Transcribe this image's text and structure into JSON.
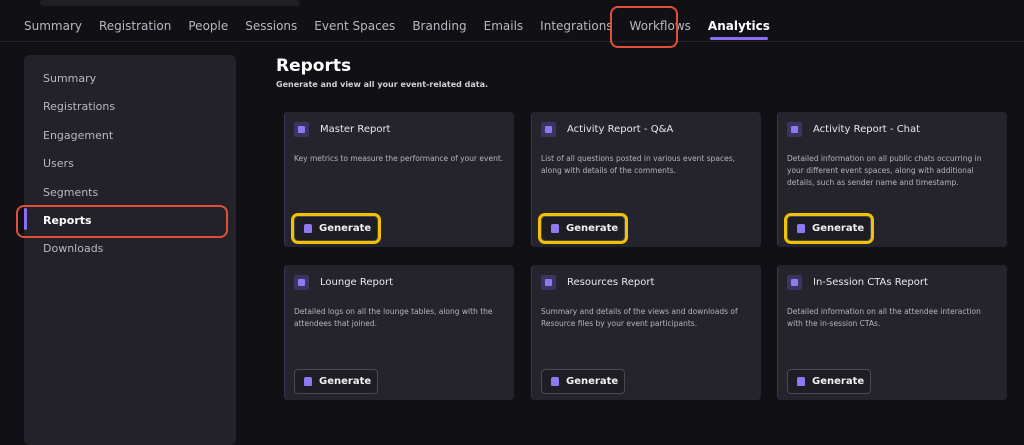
{
  "nav": {
    "tabs": [
      "Summary",
      "Registration",
      "People",
      "Sessions",
      "Event Spaces",
      "Branding",
      "Emails",
      "Integrations",
      "Workflows",
      "Analytics"
    ],
    "active": "Analytics"
  },
  "sidebar": {
    "items": [
      "Summary",
      "Registrations",
      "Engagement",
      "Users",
      "Segments",
      "Reports",
      "Downloads"
    ],
    "active": "Reports"
  },
  "page": {
    "title": "Reports",
    "subtitle": "Generate and view all your event-related data."
  },
  "cards": [
    {
      "title": "Master Report",
      "desc": "Key metrics to measure the performance of your event.",
      "button": "Generate",
      "icon": "document-icon"
    },
    {
      "title": "Activity Report - Q&A",
      "desc": "List of all questions posted in various event spaces, along with details of the comments.",
      "button": "Generate",
      "icon": "qa-icon"
    },
    {
      "title": "Activity Report - Chat",
      "desc": "Detailed information on all public chats occurring in your different event spaces, along with additional details, such as sender name and timestamp.",
      "button": "Generate",
      "icon": "chat-icon"
    },
    {
      "title": "Lounge Report",
      "desc": "Detailed logs on all the lounge tables, along with the attendees that joined.",
      "button": "Generate",
      "icon": "lounge-icon"
    },
    {
      "title": "Resources Report",
      "desc": "Summary and details of the views and downloads of Resource files by your event participants.",
      "button": "Generate",
      "icon": "resources-icon"
    },
    {
      "title": "In-Session CTAs Report",
      "desc": "Detailed information on all the attendee interaction with the in-session CTAs.",
      "button": "Generate",
      "icon": "cta-icon"
    }
  ],
  "colors": {
    "accent": "#8a6ff0",
    "highlight_red": "#e0503a",
    "highlight_yellow": "#f2c200"
  }
}
